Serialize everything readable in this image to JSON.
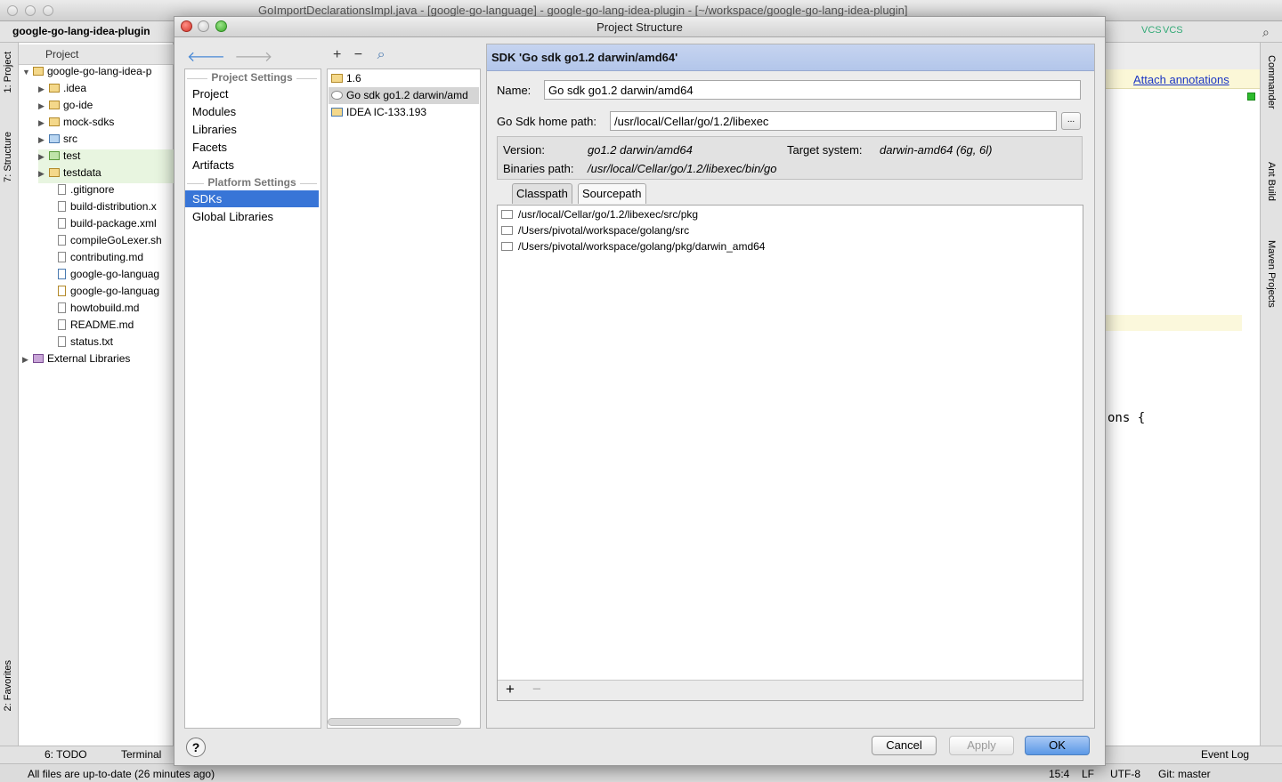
{
  "ide": {
    "window_title": "GoImportDeclarationsImpl.java - [google-go-language] - google-go-lang-idea-plugin - [~/workspace/google-go-lang-idea-plugin]",
    "breadcrumb": "google-go-lang-idea-plugin",
    "left_tabs": [
      "1: Project",
      "7: Structure",
      "2: Favorites"
    ],
    "right_tabs": [
      "Commander",
      "Ant Build",
      "Maven Projects"
    ],
    "toolbar_labels": [
      "VCS",
      "VCS"
    ],
    "project_panel": {
      "header": "Project",
      "tree": [
        {
          "label": "google-go-lang-idea-p",
          "depth": 0,
          "expanded": true,
          "kind": "module"
        },
        {
          "label": ".idea",
          "depth": 1,
          "kind": "folder"
        },
        {
          "label": "go-ide",
          "depth": 1,
          "kind": "folder"
        },
        {
          "label": "mock-sdks",
          "depth": 1,
          "kind": "folder"
        },
        {
          "label": "src",
          "depth": 1,
          "kind": "folder"
        },
        {
          "label": "test",
          "depth": 1,
          "kind": "folder"
        },
        {
          "label": "testdata",
          "depth": 1,
          "kind": "folder"
        },
        {
          "label": ".gitignore",
          "depth": 1,
          "kind": "file"
        },
        {
          "label": "build-distribution.x",
          "depth": 1,
          "kind": "file"
        },
        {
          "label": "build-package.xml",
          "depth": 1,
          "kind": "file"
        },
        {
          "label": "compileGoLexer.sh",
          "depth": 1,
          "kind": "file"
        },
        {
          "label": "contributing.md",
          "depth": 1,
          "kind": "file"
        },
        {
          "label": "google-go-languag",
          "depth": 1,
          "kind": "file"
        },
        {
          "label": "google-go-languag",
          "depth": 1,
          "kind": "file"
        },
        {
          "label": "howtobuild.md",
          "depth": 1,
          "kind": "file"
        },
        {
          "label": "README.md",
          "depth": 1,
          "kind": "file"
        },
        {
          "label": "status.txt",
          "depth": 1,
          "kind": "file"
        },
        {
          "label": "External Libraries",
          "depth": 0,
          "kind": "library"
        }
      ]
    },
    "editor": {
      "attach_annotations": "Attach annotations",
      "code_fragment": "ons {"
    },
    "bottom_tabs": {
      "todo": "6: TODO",
      "terminal": "Terminal",
      "event_log": "Event Log"
    },
    "status": {
      "message": "All files are up-to-date (26 minutes ago)",
      "position": "15:4",
      "line_sep": "LF",
      "encoding": "UTF-8",
      "vcs": "Git: master"
    }
  },
  "dialog": {
    "title": "Project Structure",
    "nav": {
      "project_settings_header": "Project Settings",
      "project_settings": [
        "Project",
        "Modules",
        "Libraries",
        "Facets",
        "Artifacts"
      ],
      "platform_settings_header": "Platform Settings",
      "platform_settings": [
        "SDKs",
        "Global Libraries"
      ],
      "selected": "SDKs"
    },
    "sdk_list": {
      "items": [
        "1.6",
        "Go sdk go1.2 darwin/amd",
        "IDEA IC-133.193"
      ],
      "selected_index": 1
    },
    "detail": {
      "header": "SDK 'Go sdk go1.2 darwin/amd64'",
      "name_label": "Name:",
      "name_value": "Go sdk go1.2 darwin/amd64",
      "home_label": "Go Sdk home path:",
      "home_value": "/usr/local/Cellar/go/1.2/libexec",
      "browse": "...",
      "version_label": "Version:",
      "version_value": "go1.2 darwin/amd64",
      "target_label": "Target system:",
      "target_value": "darwin-amd64 (6g, 6l)",
      "binaries_label": "Binaries path:",
      "binaries_value": "/usr/local/Cellar/go/1.2/libexec/bin/go",
      "tabs": [
        "Classpath",
        "Sourcepath"
      ],
      "selected_tab": "Classpath",
      "paths": [
        "/usr/local/Cellar/go/1.2/libexec/src/pkg",
        "/Users/pivotal/workspace/golang/src",
        "/Users/pivotal/workspace/golang/pkg/darwin_amd64"
      ],
      "add": "+",
      "remove": "−"
    },
    "buttons": {
      "help": "?",
      "cancel": "Cancel",
      "apply": "Apply",
      "ok": "OK"
    },
    "colors": {
      "selection": "#3875d7",
      "header_bg": "#b3c6ea",
      "ok_button": "#5b98e6"
    }
  }
}
